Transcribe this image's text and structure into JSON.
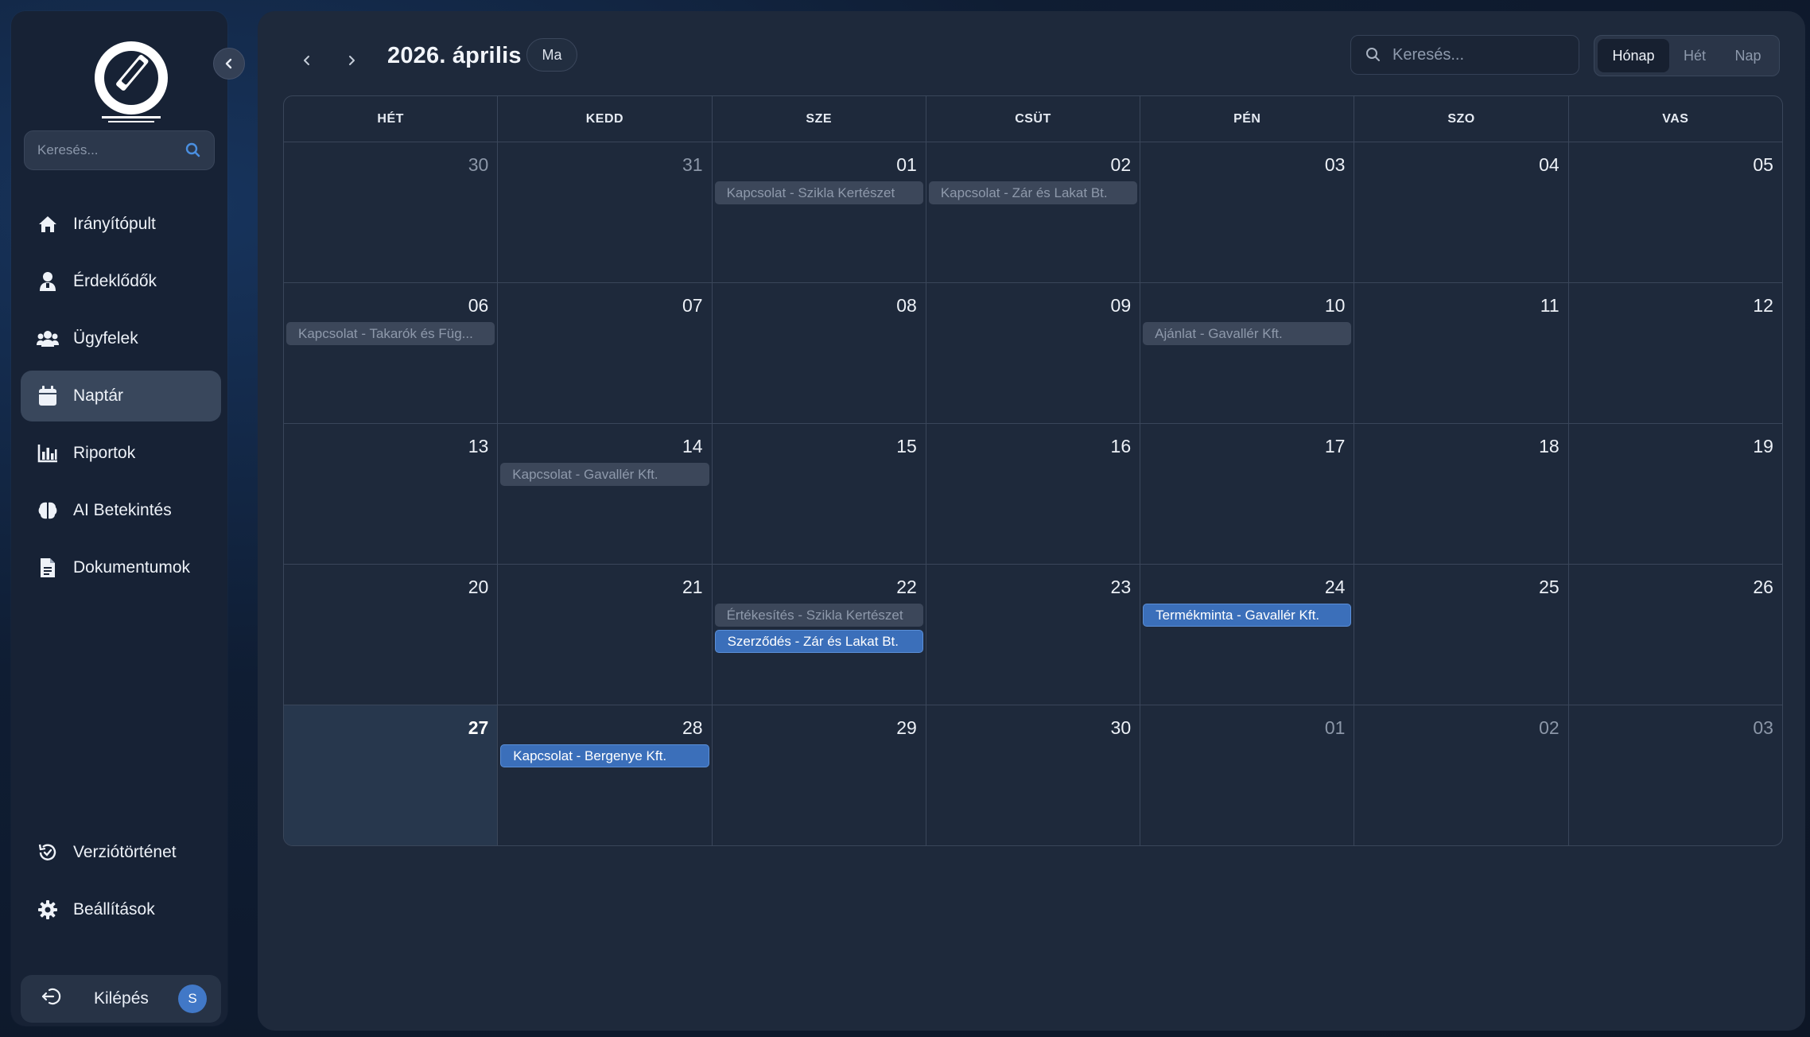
{
  "sidebar": {
    "search_placeholder": "Keresés...",
    "items": [
      {
        "label": "Irányítópult",
        "icon": "home-icon"
      },
      {
        "label": "Érdeklődők",
        "icon": "lead-user-icon"
      },
      {
        "label": "Ügyfelek",
        "icon": "users-icon"
      },
      {
        "label": "Naptár",
        "icon": "calendar-icon",
        "active": true
      },
      {
        "label": "Riportok",
        "icon": "bar-chart-icon"
      },
      {
        "label": "AI Betekintés",
        "icon": "brain-icon"
      },
      {
        "label": "Dokumentumok",
        "icon": "document-icon"
      }
    ],
    "bottom_items": [
      {
        "label": "Verziótörténet",
        "icon": "history-icon"
      },
      {
        "label": "Beállítások",
        "icon": "gear-icon"
      }
    ],
    "logout_label": "Kilépés",
    "avatar_initial": "S"
  },
  "toolbar": {
    "title": "2026. április",
    "today_label": "Ma",
    "search_placeholder": "Keresés...",
    "views": [
      "Hónap",
      "Hét",
      "Nap"
    ],
    "active_view": "Hónap"
  },
  "calendar": {
    "weekdays": [
      "HÉT",
      "KEDD",
      "SZE",
      "CSÜT",
      "PÉN",
      "SZO",
      "VAS"
    ],
    "weeks": [
      [
        {
          "day": "30",
          "muted": true,
          "events": []
        },
        {
          "day": "31",
          "muted": true,
          "events": []
        },
        {
          "day": "01",
          "events": [
            {
              "title": "Kapcsolat - Szikla Kertészet",
              "state": "past"
            }
          ]
        },
        {
          "day": "02",
          "events": [
            {
              "title": "Kapcsolat - Zár és Lakat Bt.",
              "state": "past"
            }
          ]
        },
        {
          "day": "03",
          "events": []
        },
        {
          "day": "04",
          "events": []
        },
        {
          "day": "05",
          "events": []
        }
      ],
      [
        {
          "day": "06",
          "events": [
            {
              "title": "Kapcsolat - Takarók és Füg...",
              "state": "past"
            }
          ]
        },
        {
          "day": "07",
          "events": []
        },
        {
          "day": "08",
          "events": []
        },
        {
          "day": "09",
          "events": []
        },
        {
          "day": "10",
          "events": [
            {
              "title": "Ajánlat - Gavallér Kft.",
              "state": "past"
            }
          ]
        },
        {
          "day": "11",
          "events": []
        },
        {
          "day": "12",
          "events": []
        }
      ],
      [
        {
          "day": "13",
          "events": []
        },
        {
          "day": "14",
          "events": [
            {
              "title": "Kapcsolat - Gavallér Kft.",
              "state": "past"
            }
          ]
        },
        {
          "day": "15",
          "events": []
        },
        {
          "day": "16",
          "events": []
        },
        {
          "day": "17",
          "events": []
        },
        {
          "day": "18",
          "events": []
        },
        {
          "day": "19",
          "events": []
        }
      ],
      [
        {
          "day": "20",
          "events": []
        },
        {
          "day": "21",
          "events": []
        },
        {
          "day": "22",
          "events": [
            {
              "title": "Értékesítés - Szikla Kertészet",
              "state": "past"
            },
            {
              "title": "Szerződés - Zár és Lakat Bt.",
              "state": "future"
            }
          ]
        },
        {
          "day": "23",
          "events": []
        },
        {
          "day": "24",
          "events": [
            {
              "title": "Termékminta - Gavallér Kft.",
              "state": "future"
            }
          ]
        },
        {
          "day": "25",
          "events": []
        },
        {
          "day": "26",
          "events": []
        }
      ],
      [
        {
          "day": "27",
          "today": true,
          "events": []
        },
        {
          "day": "28",
          "events": [
            {
              "title": "Kapcsolat - Bergenye Kft.",
              "state": "future"
            }
          ]
        },
        {
          "day": "29",
          "events": []
        },
        {
          "day": "30",
          "events": []
        },
        {
          "day": "01",
          "muted": true,
          "events": []
        },
        {
          "day": "02",
          "muted": true,
          "events": []
        },
        {
          "day": "03",
          "muted": true,
          "events": []
        }
      ]
    ]
  },
  "colors": {
    "accent": "#3b6fba",
    "event_past": "#3c475a",
    "panel": "#1e293b",
    "sidebar": "#172235"
  }
}
